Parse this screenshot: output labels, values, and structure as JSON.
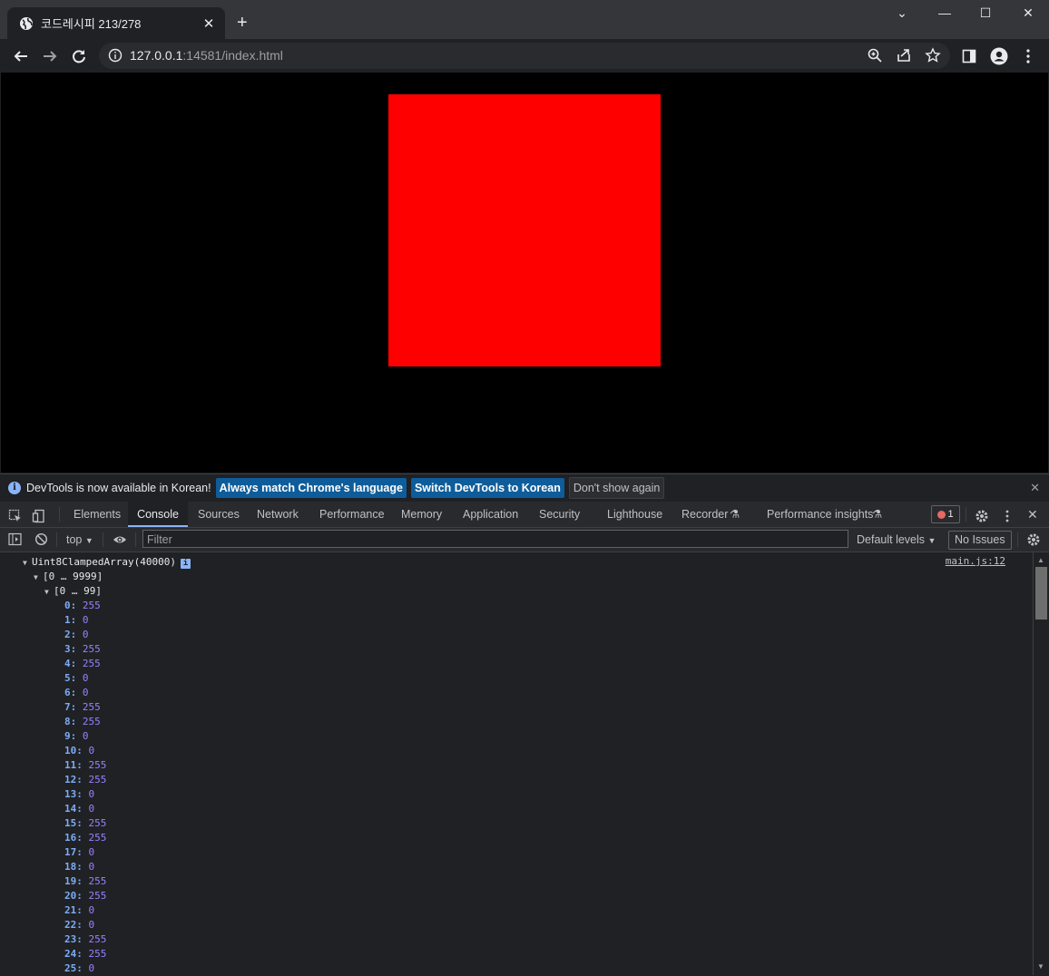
{
  "browser": {
    "tab_title": "코드레시피 213/278",
    "url_host": "127.0.0.1",
    "url_rest": ":14581/index.html"
  },
  "infobar": {
    "message": "DevTools is now available in Korean!",
    "btn_match": "Always match Chrome's language",
    "btn_switch": "Switch DevTools to Korean",
    "btn_dismiss": "Don't show again"
  },
  "devtools": {
    "tabs": [
      "Elements",
      "Console",
      "Sources",
      "Network",
      "Performance",
      "Memory",
      "Application",
      "Security",
      "Lighthouse",
      "Recorder",
      "Performance insights"
    ],
    "active_tab": "Console",
    "error_count": "1",
    "context": "top",
    "filter_placeholder": "Filter",
    "levels": "Default levels",
    "issues": "No Issues"
  },
  "console": {
    "source": "main.js:12",
    "root": "Uint8ClampedArray(40000)",
    "group1": "[0 … 9999]",
    "group2": "[0 … 99]",
    "entries": [
      {
        "k": "0",
        "v": "255"
      },
      {
        "k": "1",
        "v": "0"
      },
      {
        "k": "2",
        "v": "0"
      },
      {
        "k": "3",
        "v": "255"
      },
      {
        "k": "4",
        "v": "255"
      },
      {
        "k": "5",
        "v": "0"
      },
      {
        "k": "6",
        "v": "0"
      },
      {
        "k": "7",
        "v": "255"
      },
      {
        "k": "8",
        "v": "255"
      },
      {
        "k": "9",
        "v": "0"
      },
      {
        "k": "10",
        "v": "0"
      },
      {
        "k": "11",
        "v": "255"
      },
      {
        "k": "12",
        "v": "255"
      },
      {
        "k": "13",
        "v": "0"
      },
      {
        "k": "14",
        "v": "0"
      },
      {
        "k": "15",
        "v": "255"
      },
      {
        "k": "16",
        "v": "255"
      },
      {
        "k": "17",
        "v": "0"
      },
      {
        "k": "18",
        "v": "0"
      },
      {
        "k": "19",
        "v": "255"
      },
      {
        "k": "20",
        "v": "255"
      },
      {
        "k": "21",
        "v": "0"
      },
      {
        "k": "22",
        "v": "0"
      },
      {
        "k": "23",
        "v": "255"
      },
      {
        "k": "24",
        "v": "255"
      },
      {
        "k": "25",
        "v": "0"
      }
    ]
  },
  "colors": {
    "canvas_fill": "#ff0000",
    "page_bg": "#000000"
  }
}
